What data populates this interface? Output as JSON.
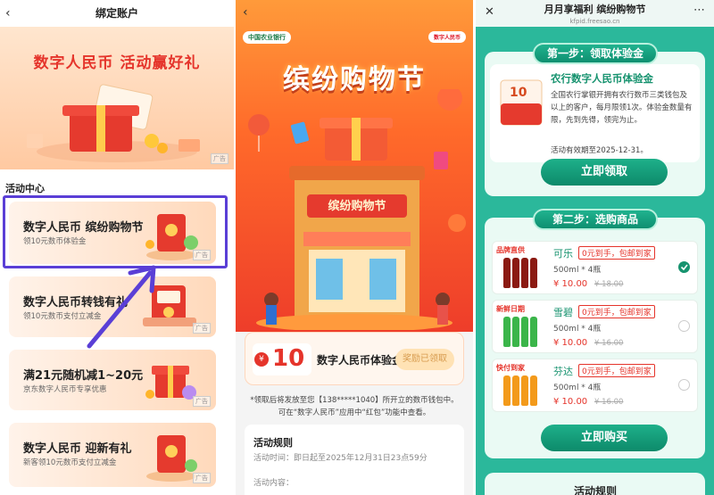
{
  "panel1": {
    "nav_title": "绑定账户",
    "back_icon": "chevron-left-icon",
    "hero_title": "数字人民币 活动赢好礼",
    "hero_ad": "广告",
    "section_title": "活动中心",
    "cards": [
      {
        "title": "数字人民币 缤纷购物节",
        "sub": "领10元数币体验金",
        "ad": "广告"
      },
      {
        "title": "数字人民币转钱有礼",
        "sub": "领10元数币支付立减金",
        "ad": "广告"
      },
      {
        "title": "满21元随机减1~20元",
        "sub": "京东数字人民币专享优惠",
        "ad": "广告"
      },
      {
        "title": "数字人民币 迎新有礼",
        "sub": "新客领10元数币支付立减金",
        "ad": "广告"
      }
    ],
    "highlight_color": "#5a3fd6"
  },
  "panel2": {
    "bank_name": "中国农业银行",
    "ecny_name": "数字人民币",
    "festival_title": "缤纷购物节",
    "store_sign": "缤纷购物节",
    "coupon": {
      "currency_symbol": "¥",
      "amount": "10",
      "name": "数字人民币体验金",
      "button": "奖励已领取"
    },
    "notice": "*领取后将发放至您【138*****1040】所开立的数币钱包中。可在“数字人民币”应用中“红包”功能中查看。",
    "rules": {
      "title": "活动规则",
      "time": "活动时间：即日起至2025年12月31日23点59分",
      "content": "活动内容："
    }
  },
  "panel3": {
    "nav_title": "月月享福利 缤纷购物节",
    "nav_url": "kfpid.freesao.cn",
    "step1": {
      "label": "第一步：领取体验金",
      "envelope_amount": "10",
      "bank_title": "农行数字人民币体验金",
      "desc": "全国农行掌银开拥有农行数币三类钱包及以上的客户，每月限领1次。体验金数量有限，先到先得，领完为止。",
      "expiry": "活动有效期至2025-12-31。",
      "button": "立即领取"
    },
    "step2": {
      "label": "第二步：选购商品",
      "products": [
        {
          "tag": "品牌直供",
          "name": "可乐",
          "promo": "0元到手，包邮到家",
          "spec": "500ml * 4瓶",
          "price": "¥ 10.00",
          "orig": "¥ 18.00",
          "selected": true,
          "bottle_color": "#8b1a12"
        },
        {
          "tag": "新鲜日期",
          "name": "雪碧",
          "promo": "0元到手，包邮到家",
          "spec": "500ml * 4瓶",
          "price": "¥ 10.00",
          "orig": "¥ 16.00",
          "selected": false,
          "bottle_color": "#3bb54a"
        },
        {
          "tag": "快付到家",
          "name": "芬达",
          "promo": "0元到手，包邮到家",
          "spec": "500ml * 4瓶",
          "price": "¥ 10.00",
          "orig": "¥ 16.00",
          "selected": false,
          "bottle_color": "#f39a1b"
        }
      ],
      "button": "立即购买"
    },
    "rules_peek": "活动规则"
  }
}
